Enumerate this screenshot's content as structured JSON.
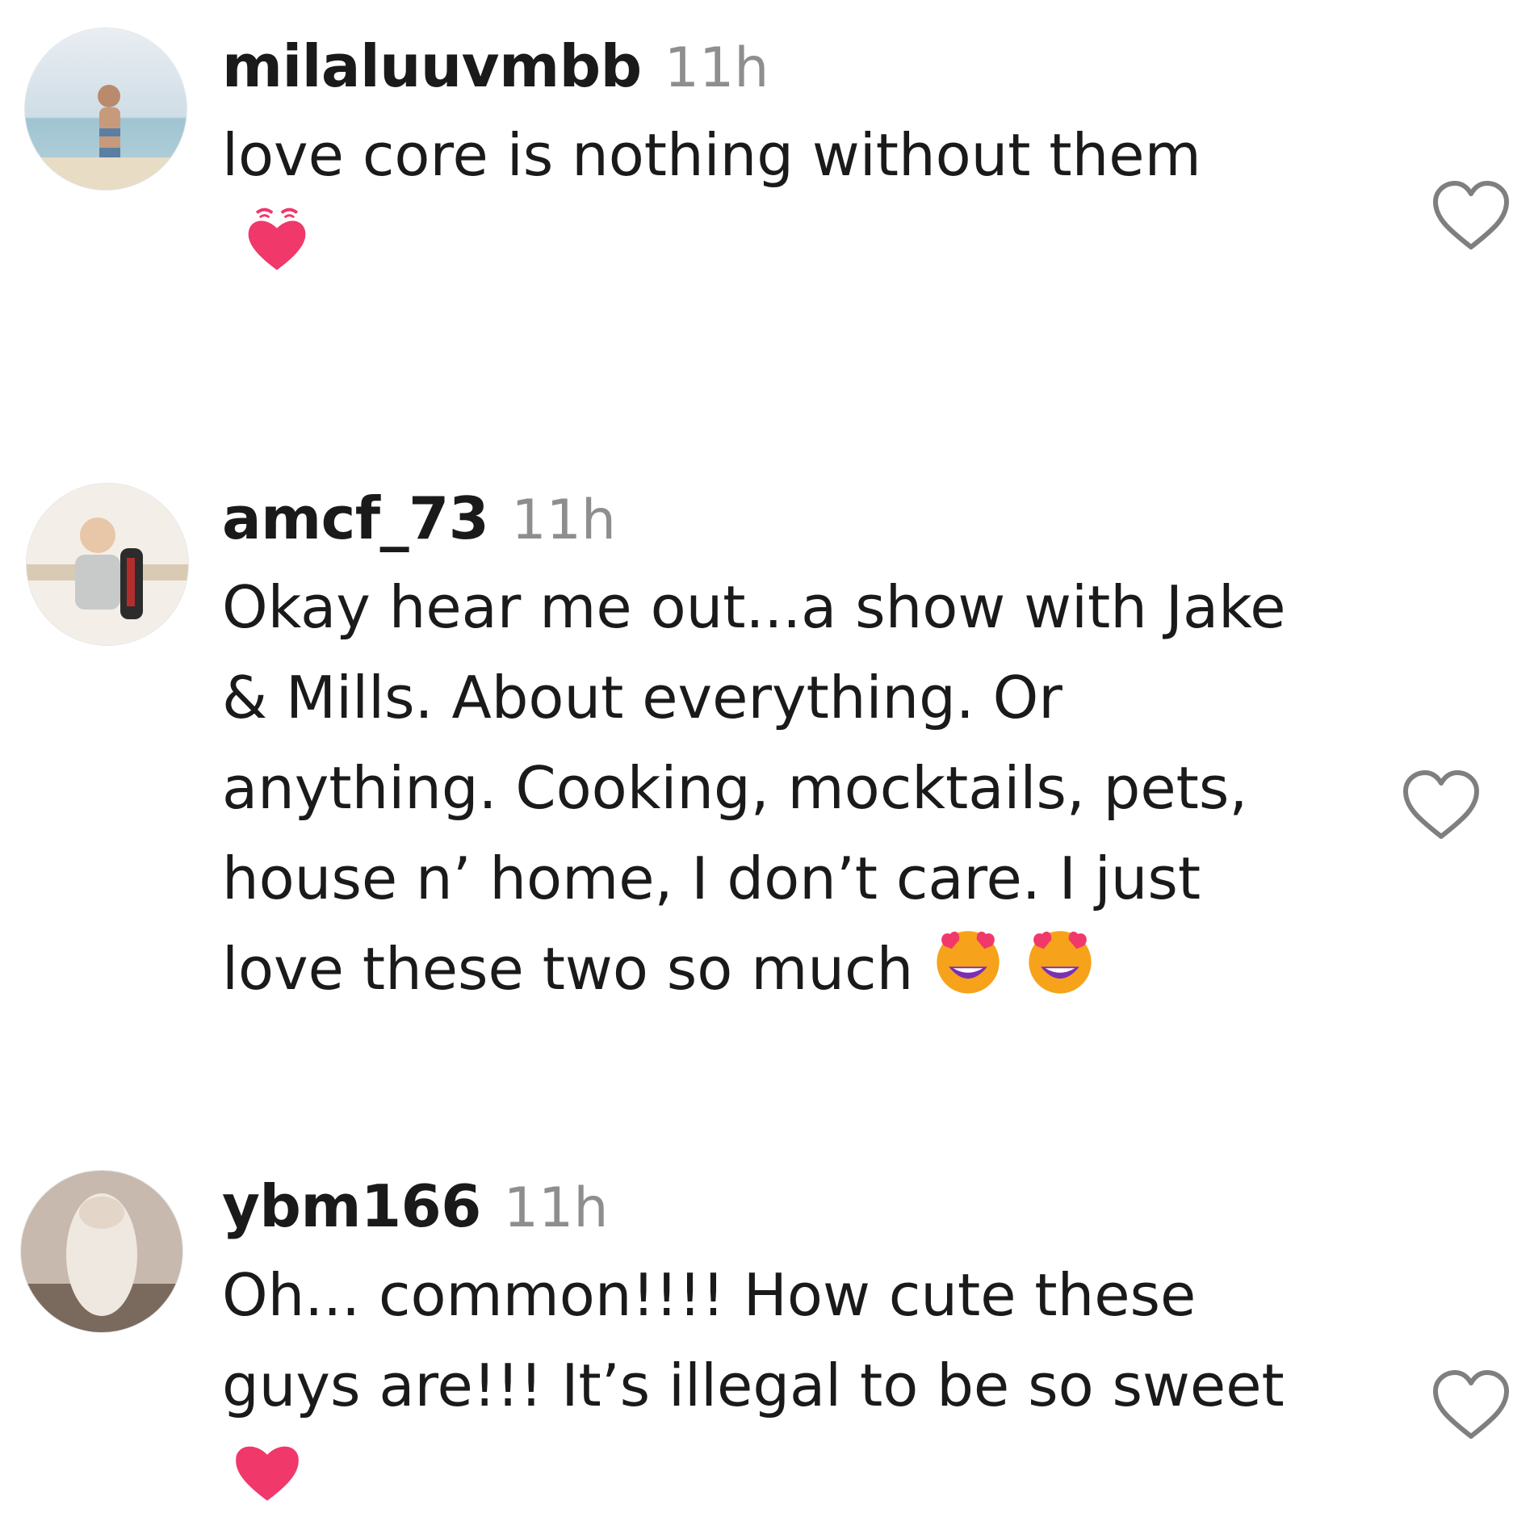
{
  "comments": [
    {
      "username": "milaluuvmbb",
      "time": "11h",
      "lines": [
        "love core is nothing without them"
      ],
      "trailing_emoji": "beating-heart"
    },
    {
      "username": "amcf_73",
      "time": "11h",
      "lines": [
        "Okay hear me out...a show with Jake",
        "& Mills. About everything. Or",
        "anything. Cooking, mocktails, pets,",
        "house n’ home, I don’t care. I just",
        "love these two so much"
      ],
      "inline_emojis": [
        "heart-eyes",
        "heart-eyes"
      ]
    },
    {
      "username": "ybm166",
      "time": "11h",
      "lines": [
        "Oh... common!!!! How cute these",
        "guys are!!! It’s illegal to be so sweet"
      ],
      "trailing_emoji": "heart"
    }
  ],
  "icons": {
    "like": "heart-outline-icon",
    "emoji_heart_color": "#f0386b",
    "emoji_face_color": "#f7a21b"
  }
}
